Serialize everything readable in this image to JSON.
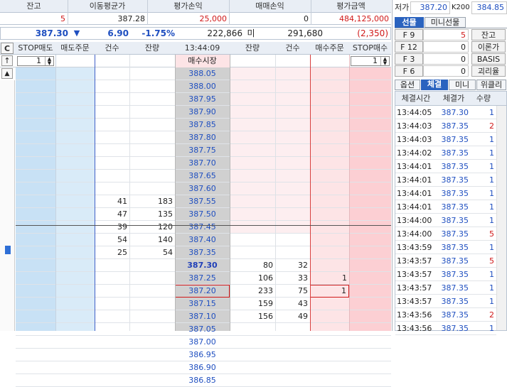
{
  "summary": {
    "labels": [
      "잔고",
      "이동평균가",
      "평가손익",
      "매매손익",
      "평가금액"
    ],
    "values": [
      "5",
      "387.28",
      "25,000",
      "0",
      "484,125,000"
    ]
  },
  "price_bar": {
    "price": "387.30",
    "arrow": "▼",
    "change": "6.90",
    "pct": "-1.75%",
    "volume": "222,866",
    "label_mi": "미",
    "mi": "291,680",
    "diff": "(2,350)"
  },
  "top_right": {
    "low_label": "저가",
    "low": "387.20",
    "k200_label": "K200",
    "k200": "384.85"
  },
  "orderbook": {
    "c_label": "C",
    "headers": [
      "STOP매도",
      "매도주문",
      "건수",
      "잔량",
      "13:44:09",
      "잔량",
      "건수",
      "매수주문",
      "STOP매수"
    ],
    "stop_sell_qty": "1",
    "stop_buy_qty": "1",
    "market_buy": "매수시장",
    "ask_prices": [
      "388.05",
      "388.00",
      "387.95",
      "387.90",
      "387.85",
      "387.80",
      "387.75",
      "387.70",
      "387.65",
      "387.60",
      "387.55",
      "387.50",
      "387.45",
      "387.40",
      "387.35"
    ],
    "ask_counts": [
      "",
      "",
      "",
      "",
      "",
      "",
      "",
      "",
      "",
      "",
      "41",
      "47",
      "39",
      "54",
      "25"
    ],
    "ask_qtys": [
      "",
      "",
      "",
      "",
      "",
      "",
      "",
      "",
      "",
      "",
      "183",
      "135",
      "120",
      "140",
      "54"
    ],
    "bid_prices": [
      "387.30",
      "387.25",
      "387.20",
      "387.15",
      "387.10",
      "387.05",
      "387.00",
      "386.95",
      "386.90",
      "386.85"
    ],
    "bid_qtys": [
      "80",
      "106",
      "233",
      "159",
      "156",
      "",
      "",
      "",
      "",
      ""
    ],
    "bid_counts": [
      "32",
      "33",
      "75",
      "43",
      "49",
      "",
      "",
      "",
      "",
      ""
    ],
    "bid_orders": [
      "",
      "1",
      "1",
      "",
      "",
      "",
      "",
      "",
      "",
      ""
    ]
  },
  "tabs_top": {
    "active": "선물",
    "inactive": "미니선물"
  },
  "fkeys": [
    {
      "key": "F 9",
      "val": "5",
      "btn": "잔고"
    },
    {
      "key": "F 12",
      "val": "0",
      "btn": "이론가"
    },
    {
      "key": "F 3",
      "val": "0",
      "btn": "BASIS"
    },
    {
      "key": "F 6",
      "val": "0",
      "btn": "괴리율"
    }
  ],
  "tabs_bottom": [
    "옵션",
    "체결",
    "미니",
    "위클리"
  ],
  "trades": {
    "headers": [
      "체결시간",
      "체결가",
      "수량"
    ],
    "rows": [
      [
        "13:44:05",
        "387.30",
        "1"
      ],
      [
        "13:44:03",
        "387.35",
        "2"
      ],
      [
        "13:44:03",
        "387.35",
        "1"
      ],
      [
        "13:44:02",
        "387.35",
        "1"
      ],
      [
        "13:44:01",
        "387.35",
        "1"
      ],
      [
        "13:44:01",
        "387.35",
        "1"
      ],
      [
        "13:44:01",
        "387.35",
        "1"
      ],
      [
        "13:44:01",
        "387.35",
        "1"
      ],
      [
        "13:44:00",
        "387.35",
        "1"
      ],
      [
        "13:44:00",
        "387.35",
        "5"
      ],
      [
        "13:43:59",
        "387.35",
        "1"
      ],
      [
        "13:43:57",
        "387.35",
        "5"
      ],
      [
        "13:43:57",
        "387.35",
        "1"
      ],
      [
        "13:43:57",
        "387.35",
        "1"
      ],
      [
        "13:43:57",
        "387.35",
        "1"
      ],
      [
        "13:43:56",
        "387.35",
        "2"
      ],
      [
        "13:43:56",
        "387.35",
        "1"
      ]
    ]
  },
  "colors": {
    "sell_bg": "#c8e1f5",
    "buy_bg": "#fde4e6",
    "price_bg": "#d0d0d0",
    "blue": "#1f4fc0",
    "red": "#d01818"
  }
}
